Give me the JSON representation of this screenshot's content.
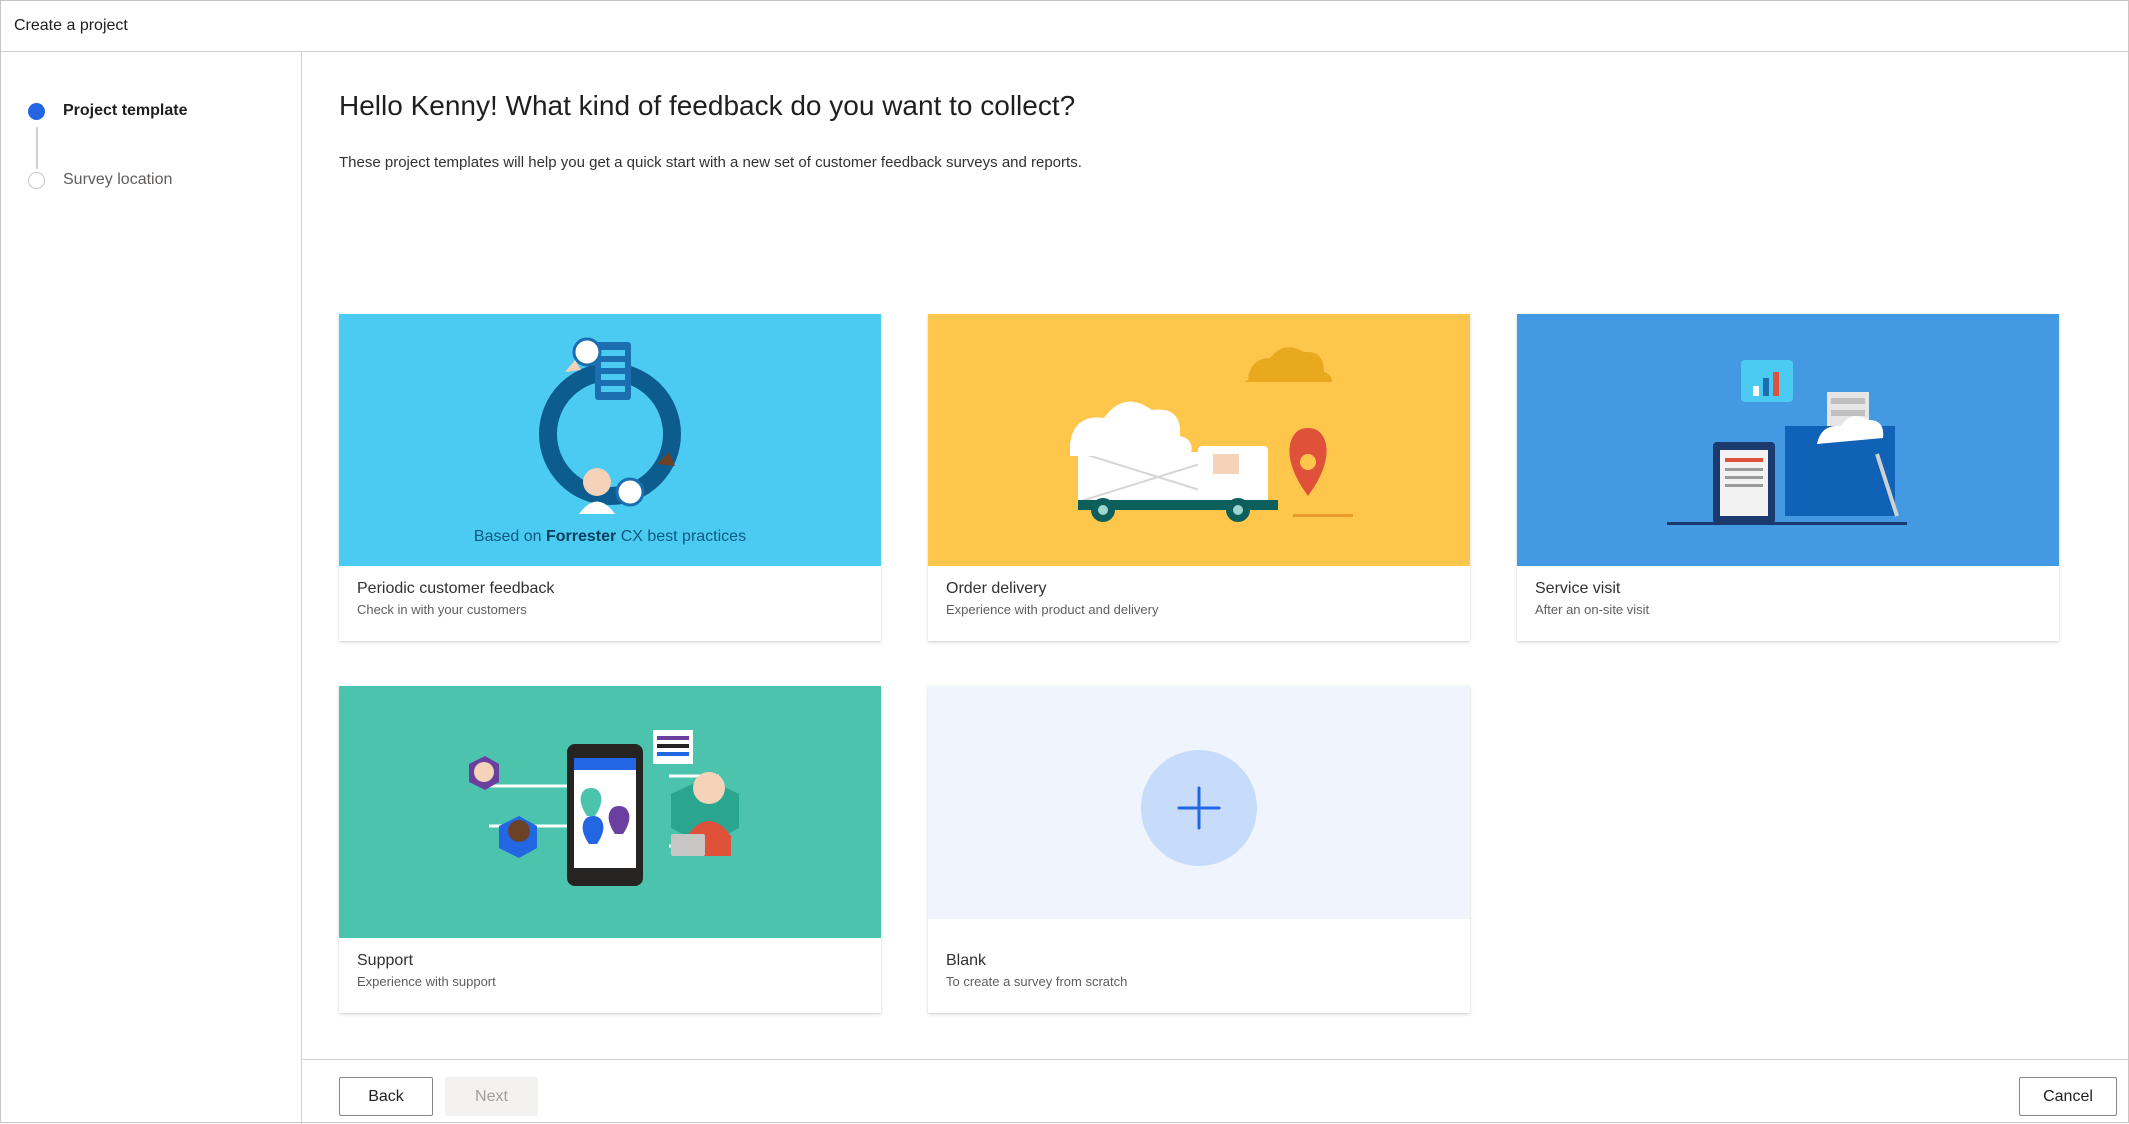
{
  "window": {
    "title": "Create a project"
  },
  "steps": [
    {
      "label": "Project template",
      "state": "active"
    },
    {
      "label": "Survey location",
      "state": "inactive"
    }
  ],
  "main": {
    "heading": "Hello Kenny! What kind of feedback do you want to collect?",
    "description": "These project templates will help you get a quick start with a new set of customer feedback surveys and reports."
  },
  "templates": [
    {
      "title": "Periodic customer feedback",
      "subtitle": "Check in with your customers",
      "art_color": "#4ccbf2",
      "caption_prefix": "Based on",
      "caption_brand": "Forrester",
      "caption_suffix": "CX best practices"
    },
    {
      "title": "Order delivery",
      "subtitle": "Experience with product and delivery",
      "art_color": "#ffc64c"
    },
    {
      "title": "Service visit",
      "subtitle": "After an on-site visit",
      "art_color": "#4399e2"
    },
    {
      "title": "Support",
      "subtitle": "Experience with support",
      "art_color": "#4bc3ad"
    },
    {
      "title": "Blank",
      "subtitle": "To create a survey from scratch",
      "art_color": "#eff4fd",
      "icon": "plus-icon"
    }
  ],
  "footer": {
    "back_label": "Back",
    "next_label": "Next",
    "cancel_label": "Cancel"
  },
  "colors": {
    "accent": "#2266e3"
  }
}
